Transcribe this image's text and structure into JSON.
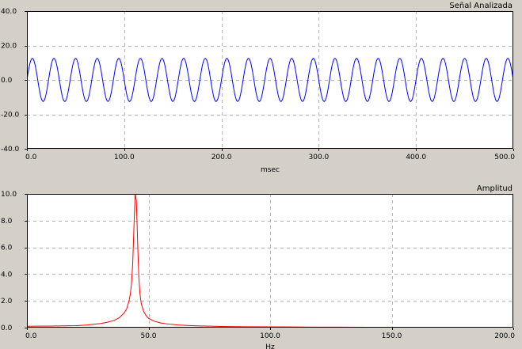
{
  "chart_data": [
    {
      "type": "line",
      "title": "Señal Analizada",
      "xlabel": "msec",
      "ylabel": "",
      "xlim": [
        0,
        500
      ],
      "ylim": [
        -40,
        40
      ],
      "x_ticks": [
        0,
        100,
        200,
        300,
        400,
        500
      ],
      "x_tick_labels": [
        "0.0",
        "100.0",
        "200.0",
        "300.0",
        "400.0",
        "500.0"
      ],
      "y_ticks": [
        40,
        20,
        0,
        -20,
        -40
      ],
      "y_tick_labels": [
        "40.0",
        "20.0",
        "0.0",
        "-20.0",
        "-40.0"
      ],
      "grid": true,
      "series": [
        {
          "color": "#0000ff",
          "function": "sine",
          "amplitude": 12.5,
          "frequency_hz": 45,
          "x_start": 0,
          "x_end": 500
        }
      ]
    },
    {
      "type": "line",
      "title": "Amplitud",
      "xlabel": "Hz",
      "ylabel": "",
      "xlim": [
        0,
        200
      ],
      "ylim": [
        0,
        10
      ],
      "x_ticks": [
        0,
        50,
        100,
        150,
        200
      ],
      "x_tick_labels": [
        "0.0",
        "50.0",
        "100.0",
        "150.0",
        "200.0"
      ],
      "y_ticks": [
        10,
        8,
        6,
        4,
        2,
        0
      ],
      "y_tick_labels": [
        "10.0",
        "8.0",
        "6.0",
        "4.0",
        "2.0",
        "0.0"
      ],
      "grid": true,
      "series": [
        {
          "color": "#ff0000",
          "x": [
            0,
            10,
            20,
            25,
            30,
            33,
            36,
            38,
            40,
            41,
            42,
            42.5,
            43,
            43.5,
            44,
            44.5,
            45,
            45.5,
            46,
            46.5,
            47,
            48,
            49,
            50,
            52,
            55,
            58,
            62,
            66,
            70,
            75,
            80,
            90,
            100,
            110,
            120,
            130,
            140,
            150,
            160,
            170,
            175
          ],
          "y": [
            0.1,
            0.12,
            0.15,
            0.2,
            0.3,
            0.4,
            0.55,
            0.75,
            1.1,
            1.4,
            2.0,
            2.5,
            3.3,
            4.8,
            7.5,
            10.0,
            9.5,
            6.5,
            3.8,
            2.5,
            1.8,
            1.2,
            0.9,
            0.7,
            0.5,
            0.35,
            0.27,
            0.2,
            0.16,
            0.13,
            0.11,
            0.09,
            0.07,
            0.06,
            0.05,
            0.04,
            0.04,
            0.03,
            0.03,
            0.02,
            0.02,
            0.02
          ]
        }
      ]
    }
  ]
}
